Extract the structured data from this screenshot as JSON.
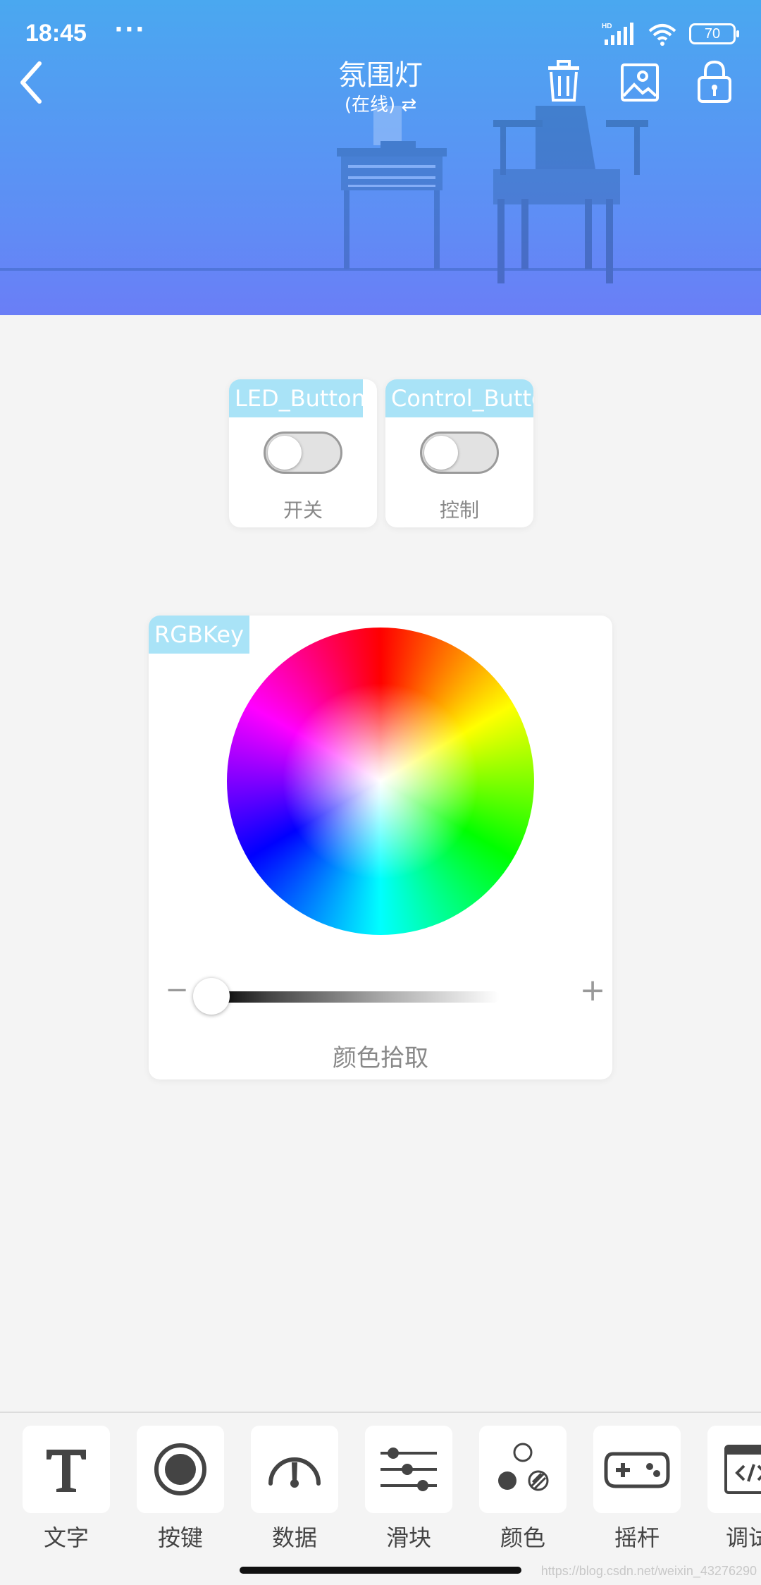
{
  "status_bar": {
    "time": "18:45",
    "dots": "···",
    "network": "HD",
    "battery": "70"
  },
  "header": {
    "title": "氛围灯",
    "subtitle": "(在线) ⇄"
  },
  "widgets": {
    "led_button": {
      "tag": "LED_Button",
      "caption": "开关",
      "on": false
    },
    "control_button": {
      "tag": "Control_Button",
      "caption": "控制",
      "on": false
    },
    "rgb": {
      "tag": "RGBKey",
      "caption": "颜色拾取",
      "minus": "−",
      "plus": "+",
      "brightness": 0
    }
  },
  "toolbar": {
    "items": [
      {
        "label": "文字",
        "icon": "text-icon"
      },
      {
        "label": "按键",
        "icon": "button-icon"
      },
      {
        "label": "数据",
        "icon": "gauge-icon"
      },
      {
        "label": "滑块",
        "icon": "slider-icon"
      },
      {
        "label": "颜色",
        "icon": "color-icon"
      },
      {
        "label": "摇杆",
        "icon": "gamepad-icon"
      },
      {
        "label": "调试",
        "icon": "code-icon"
      }
    ]
  },
  "watermark": "https://blog.csdn.net/weixin_43276290"
}
